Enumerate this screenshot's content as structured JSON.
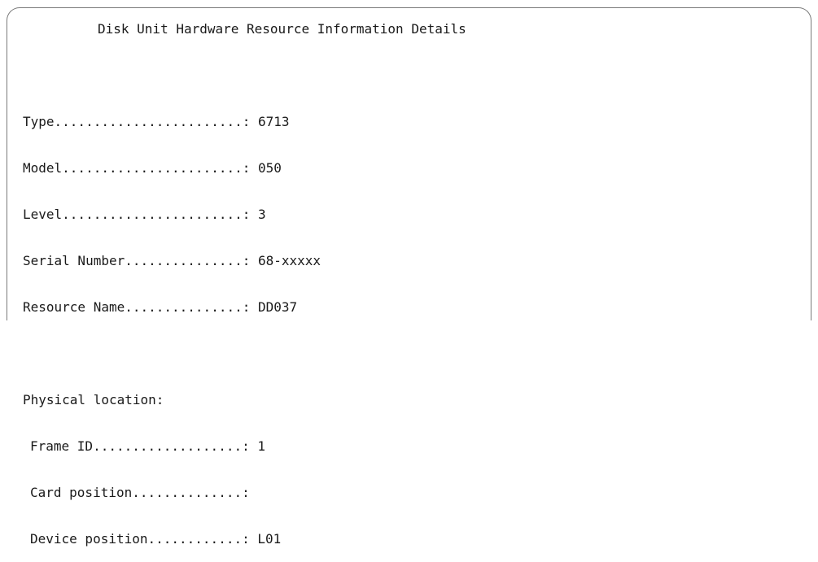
{
  "screen": {
    "title": "Disk Unit Hardware Resource Information Details"
  },
  "fields": [
    {
      "label": "Type........................:",
      "value": "6713"
    },
    {
      "label": "Model.......................:",
      "value": "050"
    },
    {
      "label": "Level.......................:",
      "value": "3"
    },
    {
      "label": "Serial Number...............:",
      "value": "68-xxxxx"
    },
    {
      "label": "Resource Name...............:",
      "value": "DD037"
    }
  ],
  "physical_location": {
    "heading": "Physical location:",
    "fields": [
      {
        "label": "Frame ID...................:",
        "value": "1"
      },
      {
        "label": "Card position..............:",
        "value": ""
      },
      {
        "label": "Device position............:",
        "value": "L01"
      }
    ]
  }
}
